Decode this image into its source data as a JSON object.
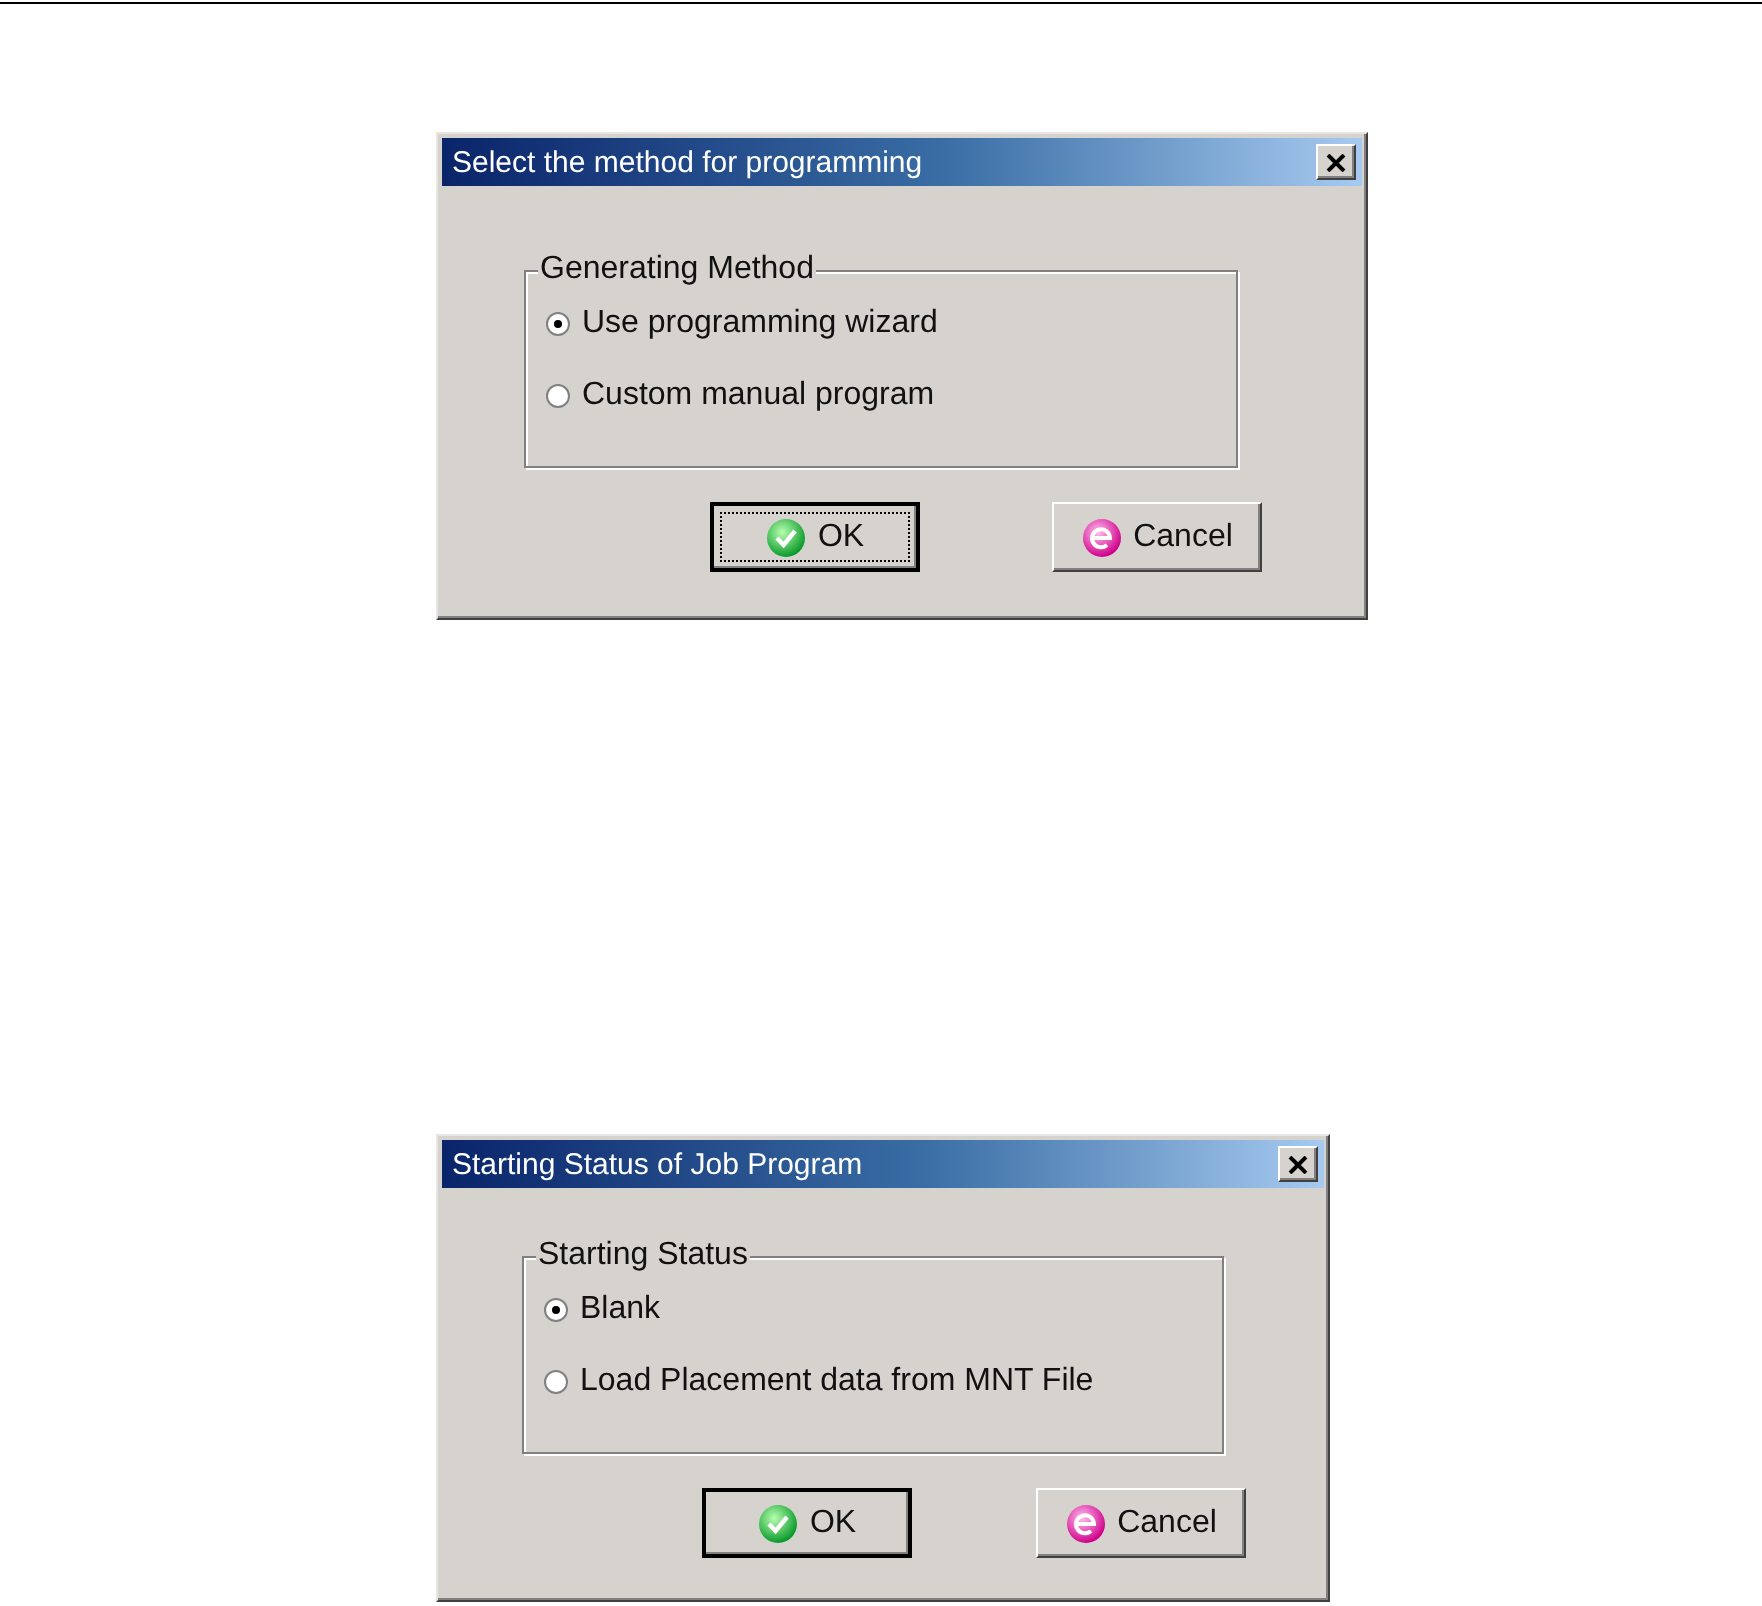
{
  "dialogs": [
    {
      "title": "Select the method for programming",
      "group": {
        "label": "Generating Method",
        "options": [
          {
            "label": "Use programming wizard",
            "selected": true
          },
          {
            "label": "Custom manual program",
            "selected": false
          }
        ]
      },
      "buttons": [
        {
          "label": "OK",
          "kind": "ok",
          "default": true,
          "focused": true
        },
        {
          "label": "Cancel",
          "kind": "cancel",
          "default": false,
          "focused": false
        }
      ]
    },
    {
      "title": "Starting Status of Job Program",
      "group": {
        "label": "Starting Status",
        "options": [
          {
            "label": "Blank",
            "selected": true
          },
          {
            "label": "Load Placement data from MNT File",
            "selected": false
          }
        ]
      },
      "buttons": [
        {
          "label": "OK",
          "kind": "ok",
          "default": true,
          "focused": false
        },
        {
          "label": "Cancel",
          "kind": "cancel",
          "default": false,
          "focused": false
        }
      ]
    }
  ]
}
